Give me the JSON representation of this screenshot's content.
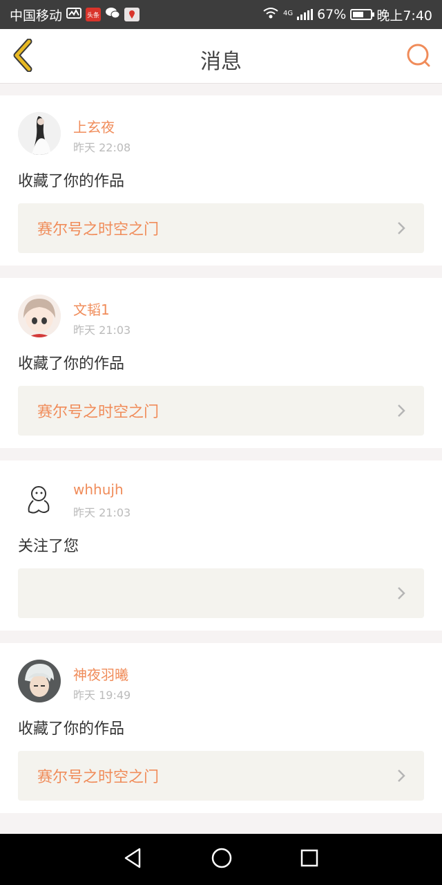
{
  "status_bar": {
    "carrier": "中国移动",
    "app_badge_text": "头条",
    "network": "4G",
    "battery": "67%",
    "time": "晚上7:40"
  },
  "header": {
    "title": "消息",
    "back_icon": "chevron-left-icon",
    "search_icon": "search-icon"
  },
  "colors": {
    "accent": "#f08c5a",
    "back_accent": "#e8b923"
  },
  "messages": [
    {
      "username": "上玄夜",
      "time": "昨天 22:08",
      "action": "收藏了你的作品",
      "work": "赛尔号之时空之门"
    },
    {
      "username": "文韬1",
      "time": "昨天 21:03",
      "action": "收藏了你的作品",
      "work": "赛尔号之时空之门"
    },
    {
      "username": "whhujh",
      "time": "昨天 21:03",
      "action": "关注了您",
      "work": ""
    },
    {
      "username": "神夜羽曦",
      "time": "昨天 19:49",
      "action": "收藏了你的作品",
      "work": "赛尔号之时空之门"
    }
  ],
  "system_nav": [
    "back-triangle-icon",
    "home-circle-icon",
    "recents-square-icon"
  ]
}
